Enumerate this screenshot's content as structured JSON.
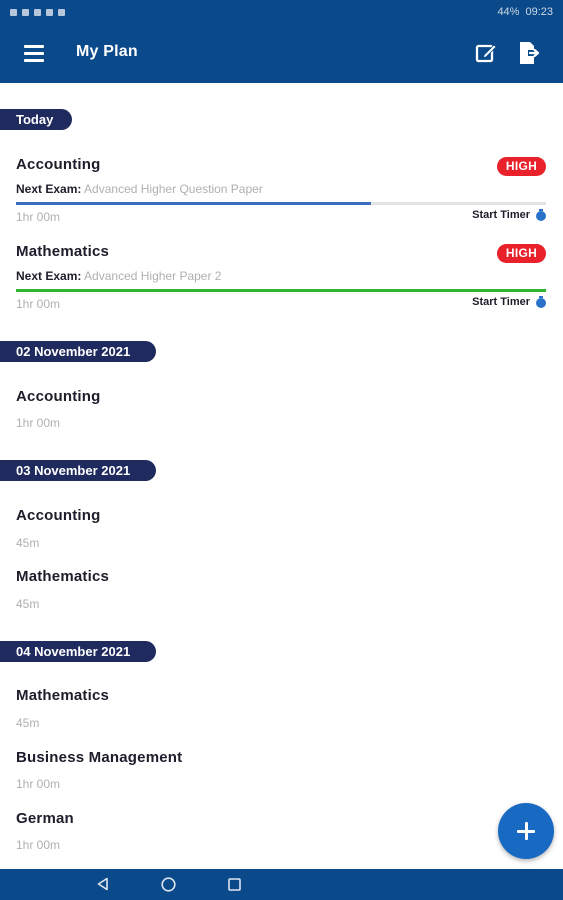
{
  "status_bar": {
    "battery": "44%",
    "time": "09:23"
  },
  "app_bar": {
    "title": "My Plan"
  },
  "sections": [
    {
      "date": "Today",
      "items": [
        {
          "subject": "Accounting",
          "priority": "HIGH",
          "next_exam_label": "Next Exam:",
          "next_exam": "Advanced Higher Question Paper",
          "duration": "1hr 00m",
          "progress": 0.67,
          "progress_color": "#3a6fc0",
          "start_timer": "Start Timer"
        },
        {
          "subject": "Mathematics",
          "priority": "HIGH",
          "next_exam_label": "Next Exam:",
          "next_exam": "Advanced Higher Paper 2",
          "duration": "1hr 00m",
          "progress": 1.0,
          "progress_color": "#2fb82f",
          "start_timer": "Start Timer"
        }
      ]
    },
    {
      "date": "02 November 2021",
      "items": [
        {
          "subject": "Accounting",
          "duration": "1hr 00m"
        }
      ]
    },
    {
      "date": "03 November 2021",
      "items": [
        {
          "subject": "Accounting",
          "duration": "45m"
        },
        {
          "subject": "Mathematics",
          "duration": "45m"
        }
      ]
    },
    {
      "date": "04 November 2021",
      "items": [
        {
          "subject": "Mathematics",
          "duration": "45m"
        },
        {
          "subject": "Business Management",
          "duration": "1hr 00m"
        },
        {
          "subject": "German",
          "duration": "1hr 00m"
        }
      ]
    }
  ],
  "colors": {
    "app_bar": "#0a4a8a",
    "date_pill": "#1f2a5e",
    "badge": "#e8212b",
    "fab": "#1769c2"
  },
  "icons": {
    "menu": "menu-icon",
    "edit": "edit-icon",
    "export": "export-icon",
    "timer": "stopwatch-icon",
    "fab": "add-icon"
  }
}
